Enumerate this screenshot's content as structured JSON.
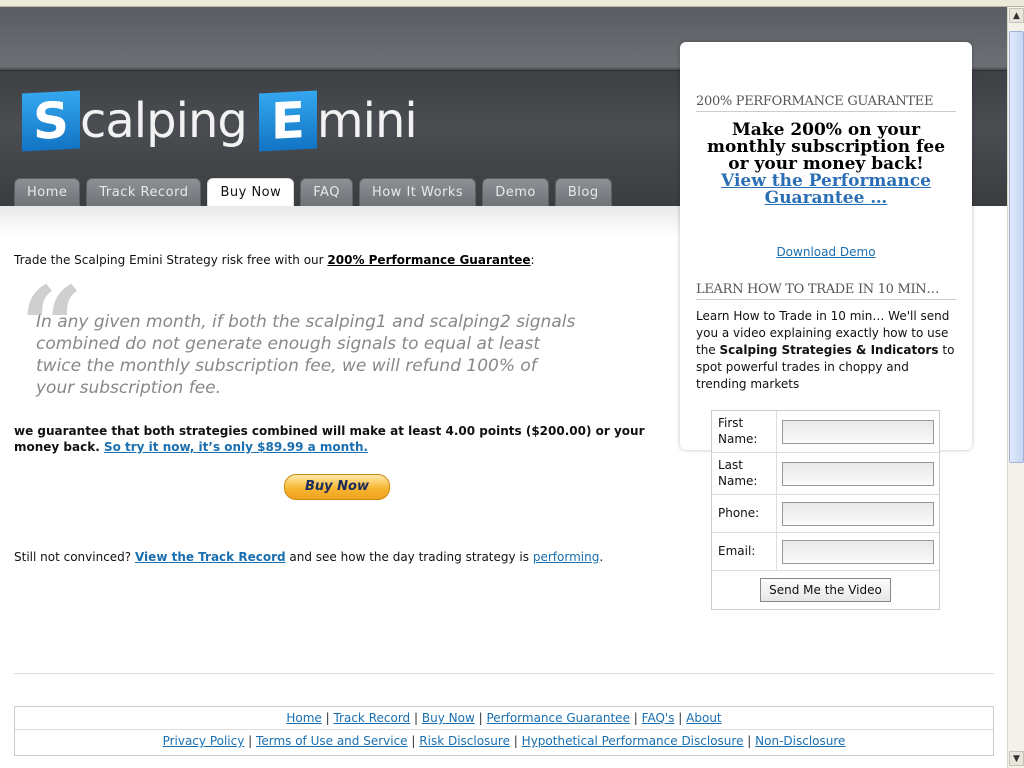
{
  "logo": {
    "letter1": "S",
    "text1": "calping",
    "letter2": "E",
    "text2": "mini"
  },
  "nav": {
    "tabs": [
      {
        "label": "Home"
      },
      {
        "label": "Track Record"
      },
      {
        "label": "Buy Now",
        "active": true
      },
      {
        "label": "FAQ"
      },
      {
        "label": "How It Works"
      },
      {
        "label": "Demo"
      },
      {
        "label": "Blog"
      }
    ]
  },
  "main": {
    "intro_prefix": "Trade the Scalping Emini Strategy risk free with our ",
    "intro_link": "200% Performance Guarantee",
    "intro_suffix": ":",
    "quote_mark": "“",
    "quote": "In any given month, if both the scalping1 and scalping2 signals combined do not generate enough signals to equal at least twice the monthly subscription fee, we will refund 100% of your subscription fee.",
    "guarantee_text": "we guarantee that both strategies combined will make at least 4.00 points ($200.00) or your money back. ",
    "guarantee_link": "So try it now, it’s only $89.99 a month.",
    "buy_now_label": "Buy Now",
    "convince_prefix": "Still not convinced? ",
    "convince_link": "View the Track Record",
    "convince_mid": " and see how the day trading strategy is ",
    "convince_link2": "performing",
    "convince_suffix": "."
  },
  "sidebar": {
    "perf_heading": "200% PERFORMANCE GUARANTEE",
    "perf_big": "Make 200% on your monthly subscription fee or your money back!",
    "perf_link": "View the Performance Guarantee …",
    "download_demo": "Download Demo",
    "learn_heading": "LEARN HOW TO TRADE IN 10 MIN…",
    "learn_text_1": "Learn How to Trade in 10 min… We'll send you a video explaining exactly how to use the ",
    "learn_text_bold": "Scalping Strategies & Indicators",
    "learn_text_2": " to spot powerful trades in choppy and trending markets",
    "form": {
      "first_name": "First Name:",
      "last_name": "Last Name:",
      "phone": "Phone:",
      "email": "Email:",
      "submit": "Send Me the Video"
    }
  },
  "footer": {
    "row1": [
      "Home",
      "Track Record",
      "Buy Now",
      "Performance Guarantee",
      "FAQ's",
      "About"
    ],
    "row2": [
      "Privacy Policy",
      "Terms of Use and Service",
      "Risk Disclosure",
      "Hypothetical Performance Disclosure",
      "Non-Disclosure"
    ],
    "separator": "|"
  },
  "colors": {
    "link": "#1a6fb0",
    "logo_blue": "#1e8ad8",
    "header_dark": "#3d4044"
  }
}
